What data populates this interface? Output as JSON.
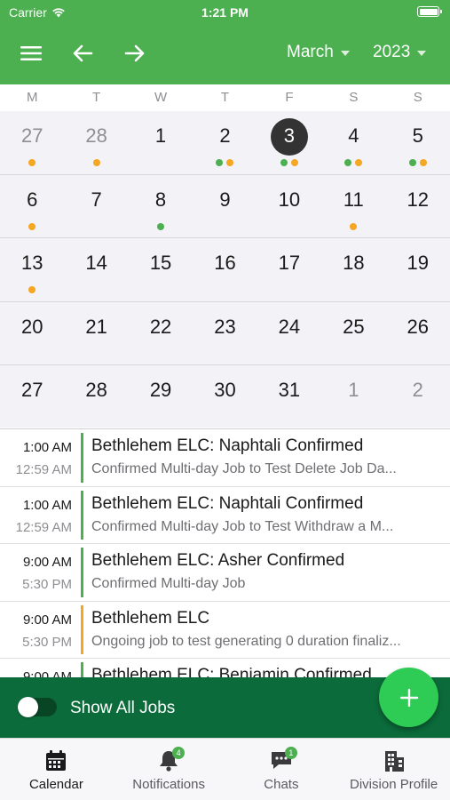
{
  "status_bar": {
    "carrier": "Carrier",
    "time": "1:21 PM"
  },
  "header": {
    "month": "March",
    "year": "2023"
  },
  "calendar": {
    "weekdays": [
      "M",
      "T",
      "W",
      "T",
      "F",
      "S",
      "S"
    ],
    "weeks": [
      [
        {
          "day": "27",
          "other": true,
          "dots": [
            "o"
          ]
        },
        {
          "day": "28",
          "other": true,
          "dots": [
            "o"
          ]
        },
        {
          "day": "1",
          "dots": []
        },
        {
          "day": "2",
          "dots": [
            "g",
            "o"
          ]
        },
        {
          "day": "3",
          "selected": true,
          "dots": [
            "g",
            "o"
          ]
        },
        {
          "day": "4",
          "dots": [
            "g",
            "o"
          ]
        },
        {
          "day": "5",
          "dots": [
            "g",
            "o"
          ]
        }
      ],
      [
        {
          "day": "6",
          "dots": [
            "o"
          ]
        },
        {
          "day": "7",
          "dots": []
        },
        {
          "day": "8",
          "dots": [
            "g"
          ]
        },
        {
          "day": "9",
          "dots": []
        },
        {
          "day": "10",
          "dots": []
        },
        {
          "day": "11",
          "dots": [
            "o"
          ]
        },
        {
          "day": "12",
          "dots": []
        }
      ],
      [
        {
          "day": "13",
          "dots": [
            "o"
          ]
        },
        {
          "day": "14",
          "dots": []
        },
        {
          "day": "15",
          "dots": []
        },
        {
          "day": "16",
          "dots": []
        },
        {
          "day": "17",
          "dots": []
        },
        {
          "day": "18",
          "dots": []
        },
        {
          "day": "19",
          "dots": []
        }
      ],
      [
        {
          "day": "20",
          "dots": []
        },
        {
          "day": "21",
          "dots": []
        },
        {
          "day": "22",
          "dots": []
        },
        {
          "day": "23",
          "dots": []
        },
        {
          "day": "24",
          "dots": []
        },
        {
          "day": "25",
          "dots": []
        },
        {
          "day": "26",
          "dots": []
        }
      ],
      [
        {
          "day": "27",
          "dots": []
        },
        {
          "day": "28",
          "dots": []
        },
        {
          "day": "29",
          "dots": []
        },
        {
          "day": "30",
          "dots": []
        },
        {
          "day": "31",
          "dots": []
        },
        {
          "day": "1",
          "other": true,
          "dots": []
        },
        {
          "day": "2",
          "other": true,
          "dots": []
        }
      ]
    ]
  },
  "jobs": [
    {
      "start": "1:00 AM",
      "end": "12:59 AM",
      "title": "Bethlehem ELC: Naphtali Confirmed",
      "description": "Confirmed Multi-day Job to Test Delete Job Da...",
      "status": "confirmed"
    },
    {
      "start": "1:00 AM",
      "end": "12:59 AM",
      "title": "Bethlehem ELC: Naphtali Confirmed",
      "description": "Confirmed Multi-day Job to Test Withdraw a M...",
      "status": "confirmed"
    },
    {
      "start": "9:00 AM",
      "end": "5:30 PM",
      "title": "Bethlehem ELC: Asher Confirmed",
      "description": "Confirmed Multi-day Job",
      "status": "confirmed"
    },
    {
      "start": "9:00 AM",
      "end": "5:30 PM",
      "title": "Bethlehem ELC",
      "description": "Ongoing job to test generating 0 duration finaliz...",
      "status": "ongoing"
    },
    {
      "start": "9:00 AM",
      "end": "",
      "title": "Bethlehem ELC: Benjamin Confirmed",
      "description": "",
      "status": "confirmed"
    }
  ],
  "show_all": {
    "label": "Show All Jobs",
    "on": false
  },
  "tabs": {
    "calendar": {
      "label": "Calendar"
    },
    "notifications": {
      "label": "Notifications",
      "badge": "4"
    },
    "chats": {
      "label": "Chats",
      "badge": "1"
    },
    "division": {
      "label": "Division Profile"
    }
  },
  "colors": {
    "primary": "#4caf50",
    "dark_green": "#0b6b3a",
    "fab": "#2ecc55",
    "confirmed": "#4caf50",
    "ongoing": "#f5a623"
  },
  "icons": {
    "menu": "hamburger-icon",
    "prev": "arrow-left-icon",
    "next": "arrow-right-icon",
    "add": "plus-icon",
    "wifi": "wifi-icon",
    "battery": "battery-icon"
  }
}
